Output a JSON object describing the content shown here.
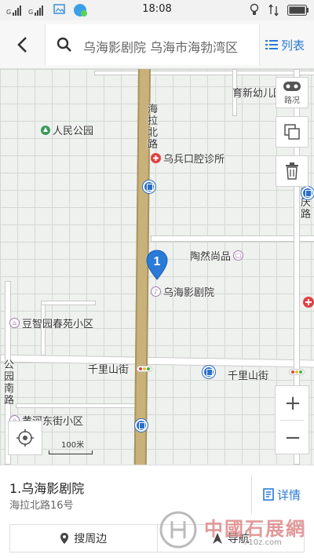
{
  "status_bar": {
    "time": "18:08",
    "signal_labels": [
      "G",
      "G"
    ]
  },
  "search": {
    "query": "乌海影剧院 乌海市海勃湾区",
    "list_label": "列表"
  },
  "map": {
    "labels": {
      "kindergarten": "育新幼儿园",
      "park": "人民公园",
      "clinic": "乌兵口腔诊所",
      "road_main": "海拉北路",
      "road_daqing": "大庆路",
      "shop": "陶然尚品",
      "theater": "乌海影剧院",
      "community1": "豆智园春苑小区",
      "road_qianli_1": "千里山街",
      "road_qianli_2": "千里山街",
      "road_gongyuan": "公园南路",
      "community2": "黄河东街小区",
      "road_left_bottom": "路"
    },
    "road_sign": "路况",
    "pin_number": "1",
    "scale_label": "100米",
    "zoom_in": "+",
    "zoom_out": "−"
  },
  "result": {
    "title": "1.乌海影剧院",
    "address": "海拉北路16号",
    "detail_label": "详情",
    "search_nearby_label": "搜周边",
    "navigate_label": "导航"
  },
  "watermark": {
    "text": "中國石展網",
    "url": "710z.com"
  },
  "colors": {
    "accent": "#2a7ad8",
    "pin": "#2a7ad8",
    "main_road": "#c9b27a"
  }
}
